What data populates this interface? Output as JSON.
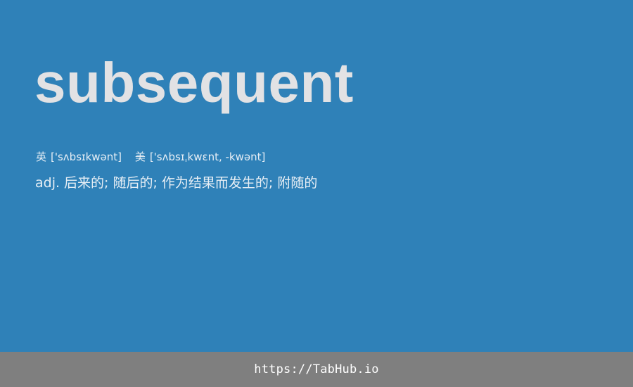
{
  "entry": {
    "word": "subsequent",
    "phonetics": [
      {
        "region": "英",
        "ipa": "['sʌbsɪkwənt]"
      },
      {
        "region": "美",
        "ipa": "['sʌbsɪˌkwɛnt, -kwənt]"
      }
    ],
    "definition": {
      "pos": "adj.",
      "meanings": "后来的; 随后的; 作为结果而发生的; 附随的"
    }
  },
  "footer": {
    "link_text": "https://TabHub.io"
  },
  "colors": {
    "card_background": "#2f81b8",
    "word_text": "#e2e2e4",
    "footer_background": "#7f7f7f"
  }
}
